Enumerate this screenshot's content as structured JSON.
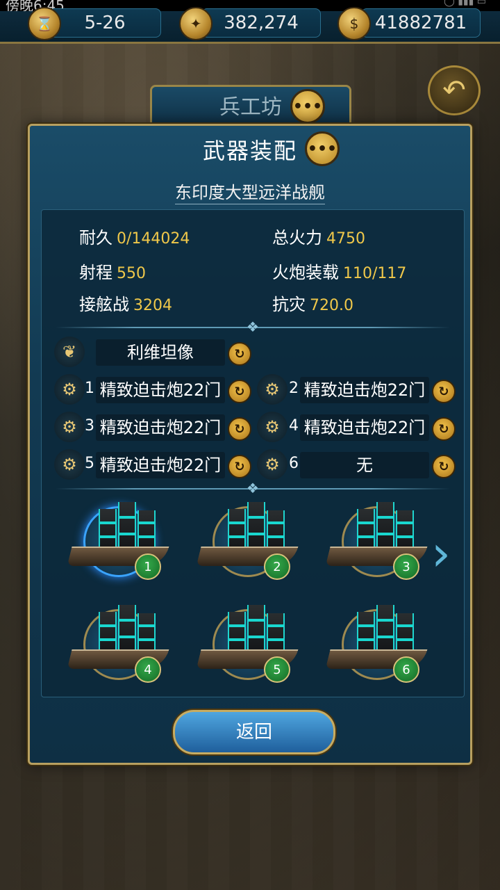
{
  "status_bar": {
    "text": "傍晚6:45"
  },
  "resources": [
    {
      "icon": "hourglass-icon",
      "value": "5-26"
    },
    {
      "icon": "compass-icon",
      "value": "382,274"
    },
    {
      "icon": "coin-icon",
      "value": "41882781"
    }
  ],
  "workshop_tab": {
    "label": "兵工坊"
  },
  "panel": {
    "title": "武器装配",
    "ship_name": "东印度大型远洋战舰",
    "stats": {
      "durability": {
        "label": "耐久",
        "value": "0/144024"
      },
      "total_firepower": {
        "label": "总火力",
        "value": "4750"
      },
      "range": {
        "label": "射程",
        "value": "550"
      },
      "cannon_load": {
        "label": "火炮装载",
        "value": "110/117"
      },
      "boarding": {
        "label": "接舷战",
        "value": "3204"
      },
      "disaster_resist": {
        "label": "抗灾",
        "value": "720.0"
      }
    },
    "figurehead": {
      "label": "利维坦像"
    },
    "cannon_slots": [
      {
        "num": "1",
        "label": "精致迫击炮22门"
      },
      {
        "num": "2",
        "label": "精致迫击炮22门"
      },
      {
        "num": "3",
        "label": "精致迫击炮22门"
      },
      {
        "num": "4",
        "label": "精致迫击炮22门"
      },
      {
        "num": "5",
        "label": "精致迫击炮22门"
      },
      {
        "num": "6",
        "label": "无"
      }
    ],
    "fleet": [
      {
        "num": "1",
        "selected": true
      },
      {
        "num": "2",
        "selected": false
      },
      {
        "num": "3",
        "selected": false
      },
      {
        "num": "4",
        "selected": false
      },
      {
        "num": "5",
        "selected": false
      },
      {
        "num": "6",
        "selected": false
      }
    ],
    "return_label": "返回"
  },
  "colors": {
    "value_yellow": "#f0c84a",
    "panel_blue": "#123a52",
    "gold_border": "#b8a060",
    "sail_cyan": "#19d7cf"
  }
}
